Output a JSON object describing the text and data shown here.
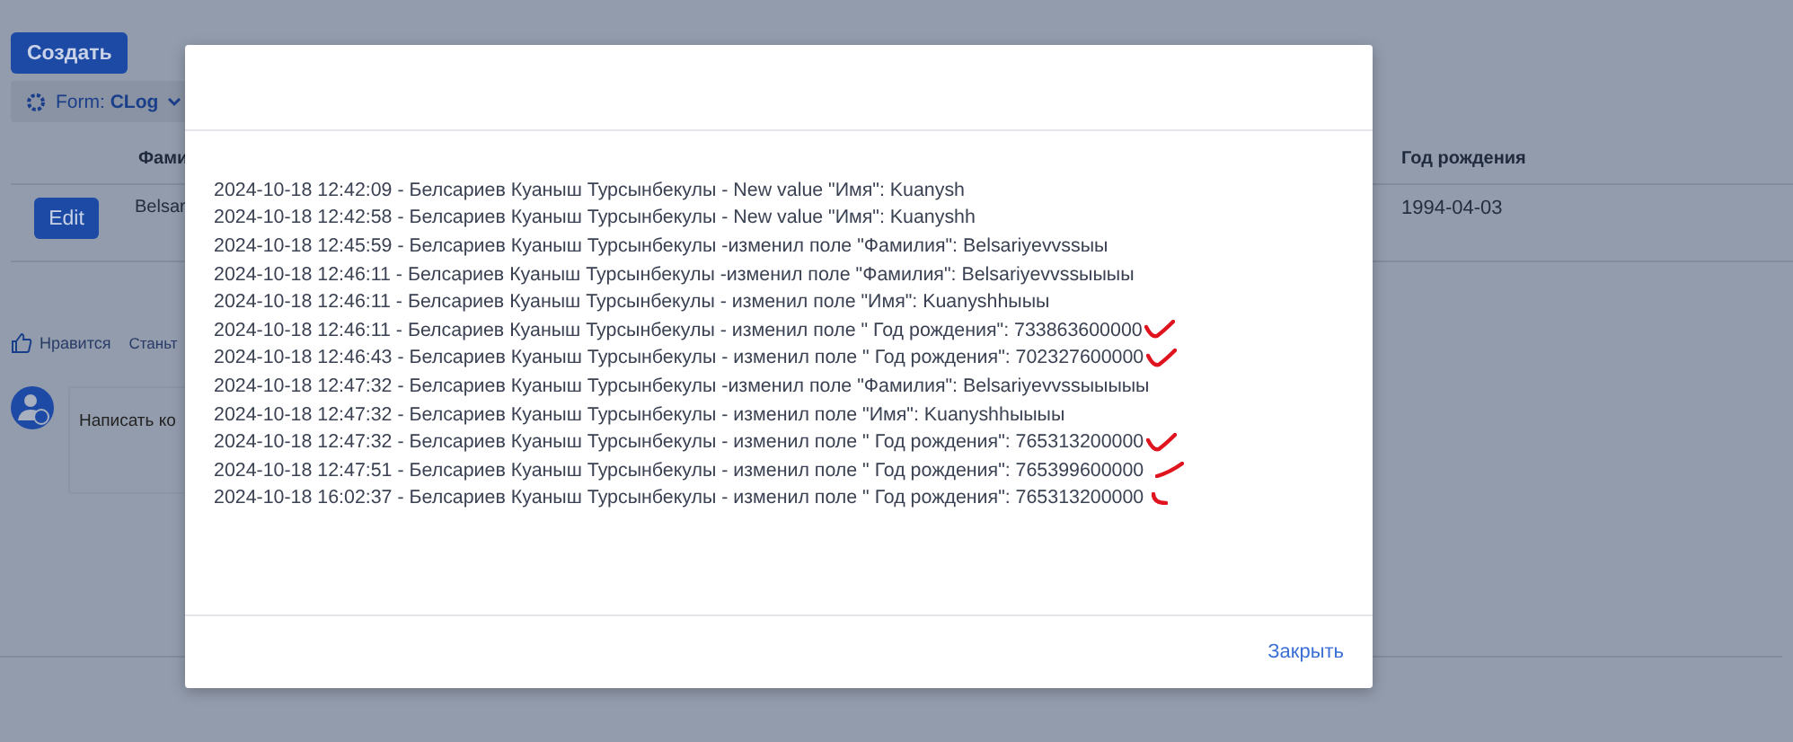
{
  "page": {
    "create_button": "Создать",
    "form_selector": {
      "prefix": "Form:",
      "value": "CLog"
    },
    "table": {
      "columns": [
        "Фами",
        "Год рождения"
      ],
      "rows": [
        {
          "action": "Edit",
          "cells": [
            "Belsar",
            "1994-04-03"
          ]
        }
      ]
    },
    "like": "Нравится",
    "become": "Станьт",
    "comment_placeholder": "Написать ко"
  },
  "dialog": {
    "lines": [
      {
        "text": "2024-10-18 12:42:09 - Белсариев Куаныш Турсынбекулы - New value \"Имя\": Kuanysh"
      },
      {
        "text": "2024-10-18 12:42:58 - Белсариев Куаныш Турсынбекулы - New value \"Имя\": Kuanyshh"
      },
      {
        "text": "2024-10-18 12:45:59 - Белсариев Куаныш Турсынбекулы -изменил поле \"Фамилия\": Belsariyevvssыы"
      },
      {
        "text": "2024-10-18 12:46:11 - Белсариев Куаныш Турсынбекулы -изменил поле \"Фамилия\": Belsariyevvssыыыы"
      },
      {
        "text": "2024-10-18 12:46:11 - Белсариев Куаныш Турсынбекулы - изменил поле \"Имя\": Kuanyshhыыы"
      },
      {
        "text": "2024-10-18 12:46:11 - Белсариев Куаныш Турсынбекулы - изменил поле \" Год рождения\": 733863600000",
        "kind": "checked"
      },
      {
        "text": "2024-10-18 12:46:43 - Белсариев Куаныш Турсынбекулы - изменил поле \" Год рождения\": 702327600000",
        "kind": "checked"
      },
      {
        "text": "2024-10-18 12:47:32 - Белсариев Куаныш Турсынбекулы -изменил поле \"Фамилия\": Belsariyevvssыыыыы"
      },
      {
        "text": "2024-10-18 12:47:32 - Белсариев Куаныш Турсынбекулы - изменил поле \"Имя\": Kuanyshhыыыы"
      },
      {
        "text": "2024-10-18 12:47:32 - Белсариев Куаныш Турсынбекулы - изменил поле \" Год рождения\": 765313200000",
        "kind": "checked"
      },
      {
        "text": "2024-10-18 12:47:51 - Белсариев Куаныш Турсынбекулы - изменил поле \" Год рождения\": 765399600000",
        "kind": "stroked"
      },
      {
        "text": "2024-10-18 16:02:37 - Белсариев Куаныш Турсынбекулы - изменил поле \" Год рождения\": 765313200000",
        "kind": "hooked"
      }
    ],
    "close_button": "Закрыть"
  }
}
